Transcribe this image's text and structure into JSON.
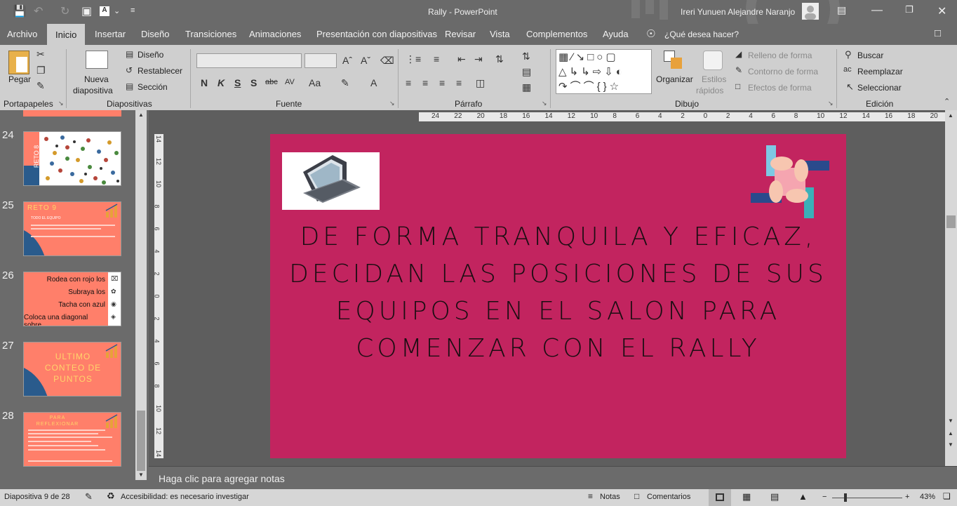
{
  "titlebar": {
    "title": "Rally  -  PowerPoint",
    "user": "Ireri Yunuen Alejandre Naranjo"
  },
  "tabs": [
    {
      "label": "Archivo"
    },
    {
      "label": "Inicio"
    },
    {
      "label": "Insertar"
    },
    {
      "label": "Diseño"
    },
    {
      "label": "Transiciones"
    },
    {
      "label": "Animaciones"
    },
    {
      "label": "Presentación con diapositivas"
    },
    {
      "label": "Revisar"
    },
    {
      "label": "Vista"
    },
    {
      "label": "Complementos"
    },
    {
      "label": "Ayuda"
    }
  ],
  "tellme": "¿Qué desea hacer?",
  "ribbon": {
    "clipboard": {
      "paste": "Pegar",
      "group": "Portapapeles"
    },
    "slides": {
      "new1": "Nueva",
      "new2": "diapositiva",
      "design": "Diseño",
      "reset": "Restablecer",
      "section": "Sección",
      "group": "Diapositivas"
    },
    "font": {
      "group": "Fuente",
      "bold": "N",
      "italic": "K",
      "underline": "S",
      "shadow": "S",
      "strike": "abc",
      "spacing": "AV",
      "case": "Aa"
    },
    "paragraph": {
      "group": "Párrafo"
    },
    "drawing": {
      "arrange": "Organizar",
      "styles1": "Estilos",
      "styles2": "rápidos",
      "fill": "Relleno de forma",
      "outline": "Contorno de forma",
      "effects": "Efectos de forma",
      "group": "Dibujo"
    },
    "editing": {
      "find": "Buscar",
      "replace": "Reemplazar",
      "select": "Seleccionar",
      "group": "Edición"
    }
  },
  "thumbnails": [
    {
      "num": "24",
      "label": "RETO 8"
    },
    {
      "num": "25",
      "title": "RETO 9",
      "line1": "TODO EL EQUIPO"
    },
    {
      "num": "26",
      "items": [
        "Rodea con rojo los",
        "Subraya los",
        "Tacha con azul",
        "Coloca una diagonal sobre"
      ]
    },
    {
      "num": "27",
      "title": "ULTIMO CONTEO DE PUNTOS"
    },
    {
      "num": "28",
      "title": "PARA REFLEXIONAR"
    }
  ],
  "ruler": {
    "h": [
      "24",
      "22",
      "20",
      "18",
      "16",
      "14",
      "12",
      "10",
      "8",
      "6",
      "4",
      "2",
      "0",
      "2",
      "4",
      "6",
      "8",
      "10",
      "12",
      "14",
      "16",
      "18",
      "20",
      "22",
      "24"
    ],
    "v": [
      "14",
      "12",
      "10",
      "8",
      "6",
      "4",
      "2",
      "0",
      "2",
      "4",
      "6",
      "8",
      "10",
      "12",
      "14"
    ]
  },
  "slide": {
    "text": "DE FORMA TRANQUILA Y EFICAZ, DECIDAN LAS POSICIONES DE SUS EQUIPOS EN EL SALON PARA COMENZAR CON EL RALLY",
    "bg": "#c2245f"
  },
  "notes": {
    "placeholder": "Haga clic para agregar notas"
  },
  "status": {
    "slide": "Diapositiva 9 de 28",
    "accessibility": "Accesibilidad: es necesario investigar",
    "notes": "Notas",
    "comments": "Comentarios",
    "zoom": "43%"
  }
}
